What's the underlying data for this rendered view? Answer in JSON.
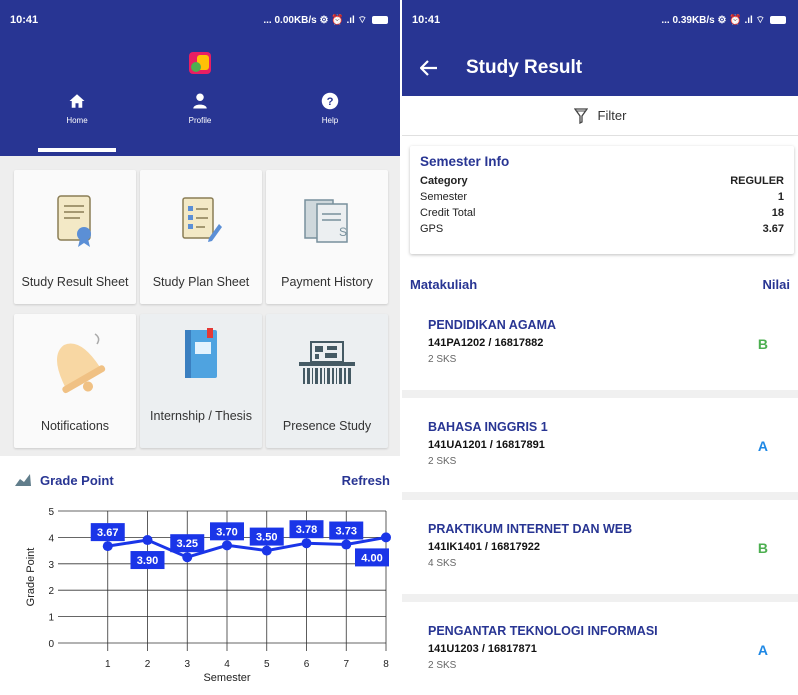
{
  "left_screen": {
    "status": {
      "time": "10:41",
      "net": "... 0.00KB/s ⚙ ⏰ .ıl ⌔"
    },
    "nav": [
      {
        "label": "Home",
        "icon": "home-icon"
      },
      {
        "label": "Profile",
        "icon": "person-icon"
      },
      {
        "label": "Help",
        "icon": "help-icon"
      }
    ],
    "tiles": [
      {
        "label": "Study Result Sheet",
        "icon": "certificate-icon"
      },
      {
        "label": "Study Plan Sheet",
        "icon": "checklist-icon"
      },
      {
        "label": "Payment History",
        "icon": "invoice-icon"
      },
      {
        "label": "Notifications",
        "icon": "bell-icon"
      },
      {
        "label": "Internship / Thesis",
        "icon": "book-icon"
      },
      {
        "label": "Presence Study",
        "icon": "barcode-icon"
      }
    ],
    "grade_point": {
      "title": "Grade Point",
      "refresh": "Refresh"
    }
  },
  "chart_data": {
    "type": "line",
    "title": "",
    "xlabel": "Semester",
    "ylabel": "Grade Point",
    "x": [
      1,
      2,
      3,
      4,
      5,
      6,
      7,
      8
    ],
    "series": [
      {
        "values": [
          3.67,
          3.9,
          3.25,
          3.7,
          3.5,
          3.78,
          3.73,
          4.0
        ],
        "labels": [
          "3.67",
          "3.90",
          "3.25",
          "3.70",
          "3.50",
          "3.78",
          "3.73",
          "4.00"
        ]
      }
    ],
    "ylim": [
      0,
      5
    ],
    "xlim": [
      0,
      8
    ],
    "yticks": [
      "0",
      "1",
      "2",
      "3",
      "4",
      "5"
    ],
    "xticks": [
      "1",
      "2",
      "3",
      "4",
      "5",
      "6",
      "7",
      "8"
    ],
    "grid": true,
    "colors": {
      "line": "#1a35e8",
      "label_bg": "#1a35e8"
    }
  },
  "right_screen": {
    "status": {
      "time": "10:41",
      "net": "... 0.39KB/s ⚙ ⏰ .ıl ⌔"
    },
    "title": "Study Result",
    "filter": "Filter",
    "semester_info": {
      "title": "Semester Info",
      "rows": [
        {
          "label": "Category",
          "value": "REGULER"
        },
        {
          "label": "Semester",
          "value": "1"
        },
        {
          "label": "Credit Total",
          "value": "18"
        },
        {
          "label": "GPS",
          "value": "3.67"
        }
      ]
    },
    "list_header": {
      "left": "Matakuliah",
      "right": "Nilai"
    },
    "courses": [
      {
        "name": "PENDIDIKAN AGAMA",
        "code": "141PA1202 / 16817882",
        "sks": "2 SKS",
        "grade": "B"
      },
      {
        "name": "BAHASA INGGRIS 1",
        "code": "141UA1201 / 16817891",
        "sks": "2 SKS",
        "grade": "A"
      },
      {
        "name": "PRAKTIKUM INTERNET DAN WEB",
        "code": "141IK1401 / 16817922",
        "sks": "4 SKS",
        "grade": "B"
      },
      {
        "name": "PENGANTAR TEKNOLOGI INFORMASI",
        "code": "141U1203 / 16817871",
        "sks": "2 SKS",
        "grade": "A"
      }
    ]
  },
  "colors": {
    "primary": "#283593",
    "grade_b": "#4caf50",
    "grade_a": "#1e88e5"
  }
}
